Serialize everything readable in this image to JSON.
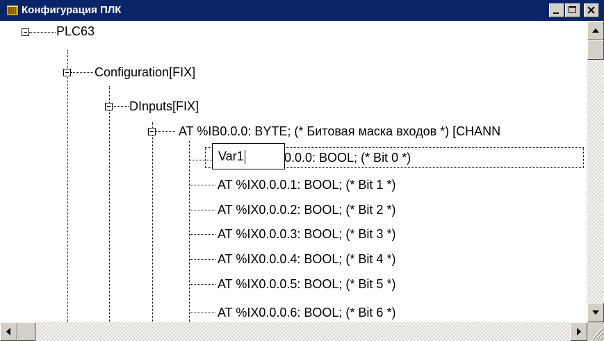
{
  "window": {
    "title": "Конфигурация ПЛК",
    "title_bar_color": "#0a246a",
    "icons": {
      "app": "plc-config-icon",
      "minimize": "minimize-icon",
      "maximize": "maximize-icon",
      "close": "close-icon"
    }
  },
  "tree": {
    "root": "PLC63",
    "configuration": "Configuration[FIX]",
    "dinputs": "DInputs[FIX]",
    "byte_channel": "AT %IB0.0.0: BYTE; (* Битовая маска входов *) [CHANN",
    "editing_item_rest": "0.0.0: BOOL; (* Bit 0 *)",
    "edit_value": "Var1",
    "items": [
      "AT %IX0.0.0.1: BOOL; (* Bit 1 *)",
      "AT %IX0.0.0.2: BOOL; (* Bit 2 *)",
      "AT %IX0.0.0.3: BOOL; (* Bit 3 *)",
      "AT %IX0.0.0.4: BOOL; (* Bit 4 *)",
      "AT %IX0.0.0.5: BOOL; (* Bit 5 *)",
      "AT %IX0.0.0.6: BOOL; (* Bit 6 *)"
    ]
  }
}
